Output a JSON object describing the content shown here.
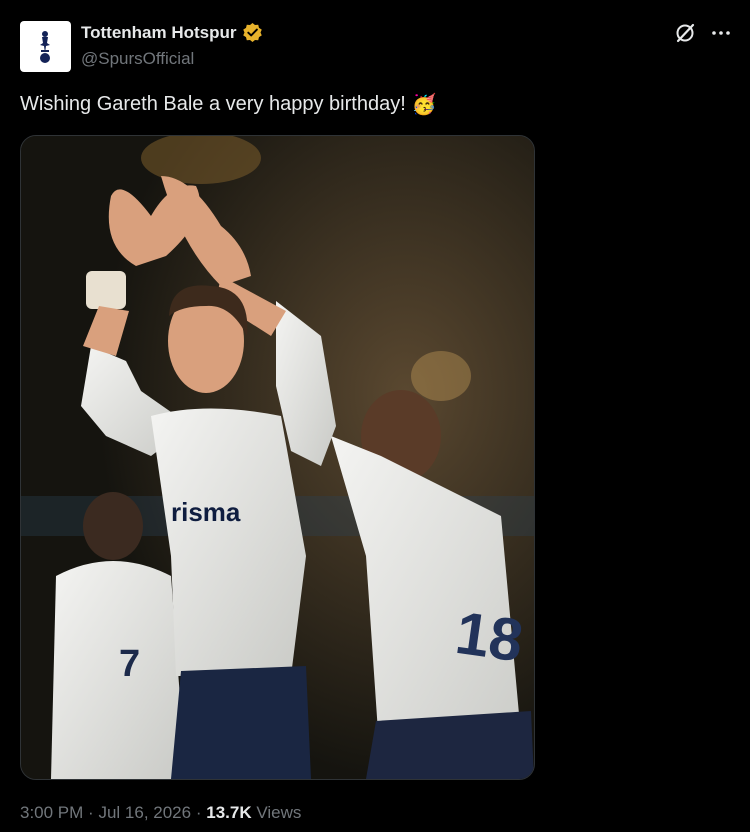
{
  "account": {
    "display_name": "Tottenham Hotspur",
    "handle": "@SpursOfficial",
    "verified_badge_color": "#e8b32c"
  },
  "tweet": {
    "text": "Wishing Gareth Bale a very happy birthday!",
    "emoji": "🥳",
    "photo_shirt_sponsor": "risma",
    "shirt_number_left_player": "7",
    "shirt_number_right_player": "18"
  },
  "meta": {
    "time": "3:00 PM",
    "date": "Jul 16, 2026",
    "separator": "·",
    "views_count": "13.7K",
    "views_label": "Views"
  },
  "icons": {
    "grok": "grok-icon",
    "more": "more-icon"
  }
}
